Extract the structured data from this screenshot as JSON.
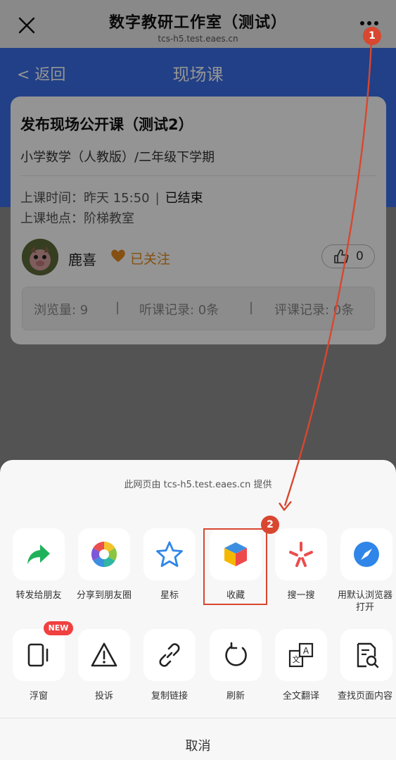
{
  "window": {
    "title": "数字教研工作室（测试）",
    "domain": "tcs-h5.test.eaes.cn"
  },
  "nav": {
    "back_label": "< 返回",
    "page_title": "现场课"
  },
  "card": {
    "title": "发布现场公开课（测试2）",
    "subject": "小学数学（人教版）/二年级下学期",
    "time_label": "上课时间：",
    "time_value": "昨天 15:50",
    "status": "已结束",
    "place_label": "上课地点：",
    "place_value": "阶梯教室",
    "teacher": "鹿喜",
    "follow_label": "已关注",
    "like_count": "0",
    "stats": {
      "views": "浏览量: 9",
      "listen": "听课记录: 0条",
      "review": "评课记录: 0条"
    }
  },
  "sheet": {
    "provider_text": "此网页由 tcs-h5.test.eaes.cn 提供",
    "row1": [
      {
        "label": "转发给朋友",
        "icon": "share-arrow-icon"
      },
      {
        "label": "分享到朋友圈",
        "icon": "moments-icon"
      },
      {
        "label": "星标",
        "icon": "star-icon"
      },
      {
        "label": "收藏",
        "icon": "favorite-cube-icon"
      },
      {
        "label": "搜一搜",
        "icon": "search-sparkle-icon"
      },
      {
        "label": "用默认浏览器打开",
        "icon": "compass-icon"
      }
    ],
    "row2": [
      {
        "label": "浮窗",
        "icon": "float-window-icon"
      },
      {
        "label": "投诉",
        "icon": "warning-icon"
      },
      {
        "label": "复制链接",
        "icon": "link-icon"
      },
      {
        "label": "刷新",
        "icon": "refresh-icon"
      },
      {
        "label": "全文翻译",
        "icon": "translate-icon"
      },
      {
        "label": "查找页面内容",
        "icon": "find-in-page-icon"
      }
    ],
    "new_badge": "NEW",
    "cancel_label": "取消"
  },
  "annotations": {
    "step1": "1",
    "step2": "2"
  },
  "colors": {
    "accent_blue": "#3a6fe8",
    "annotation_red": "#d8472f",
    "follow_orange": "#e58a1f"
  }
}
